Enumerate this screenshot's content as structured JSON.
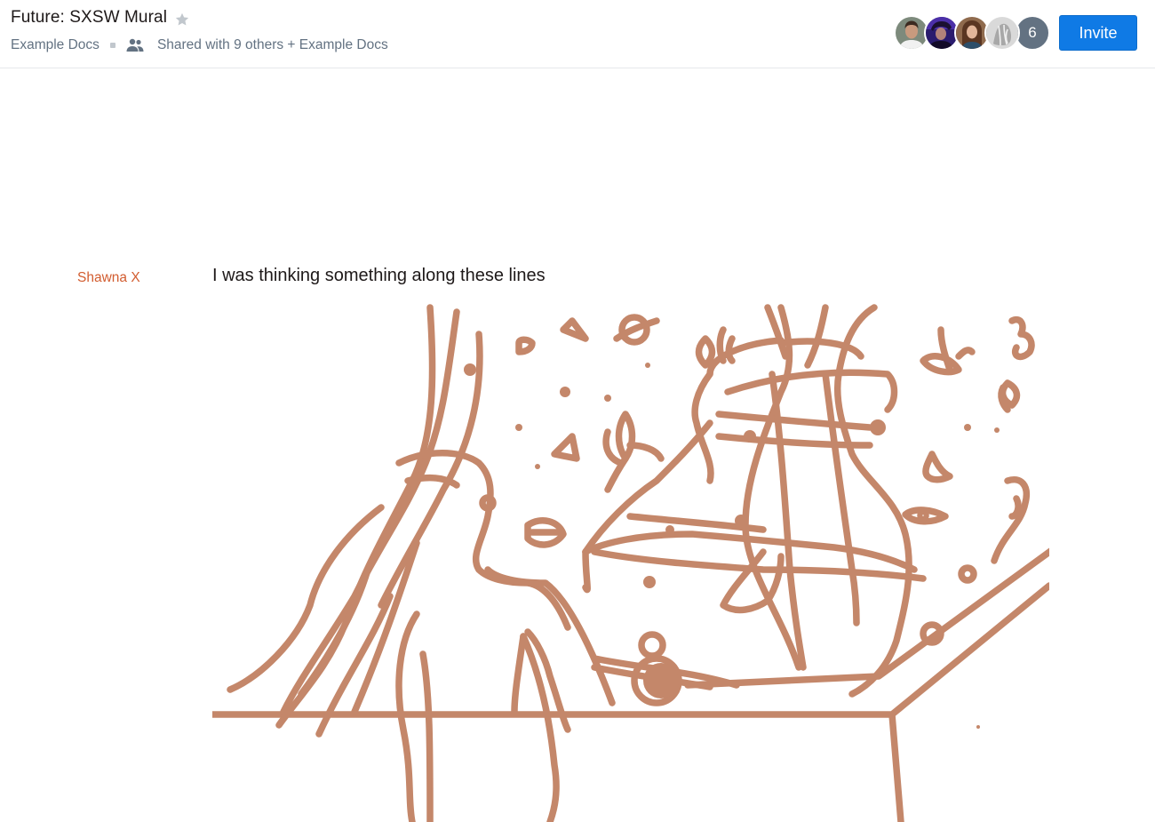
{
  "header": {
    "title": "Future: SXSW Mural",
    "star_icon": "star-icon",
    "folder": "Example Docs",
    "people_icon": "people-icon",
    "shared_text": "Shared with 9 others + Example Docs",
    "avatars": [
      "avatar-1",
      "avatar-2",
      "avatar-3",
      "avatar-4"
    ],
    "more_count": "6",
    "invite_label": "Invite"
  },
  "comment": {
    "author": "Shawna X",
    "text": "I was thinking something along these lines",
    "sketch_color": "#c4876a"
  },
  "colors": {
    "accent": "#0f7ae5",
    "author": "#d25d30",
    "muted": "#637282"
  }
}
